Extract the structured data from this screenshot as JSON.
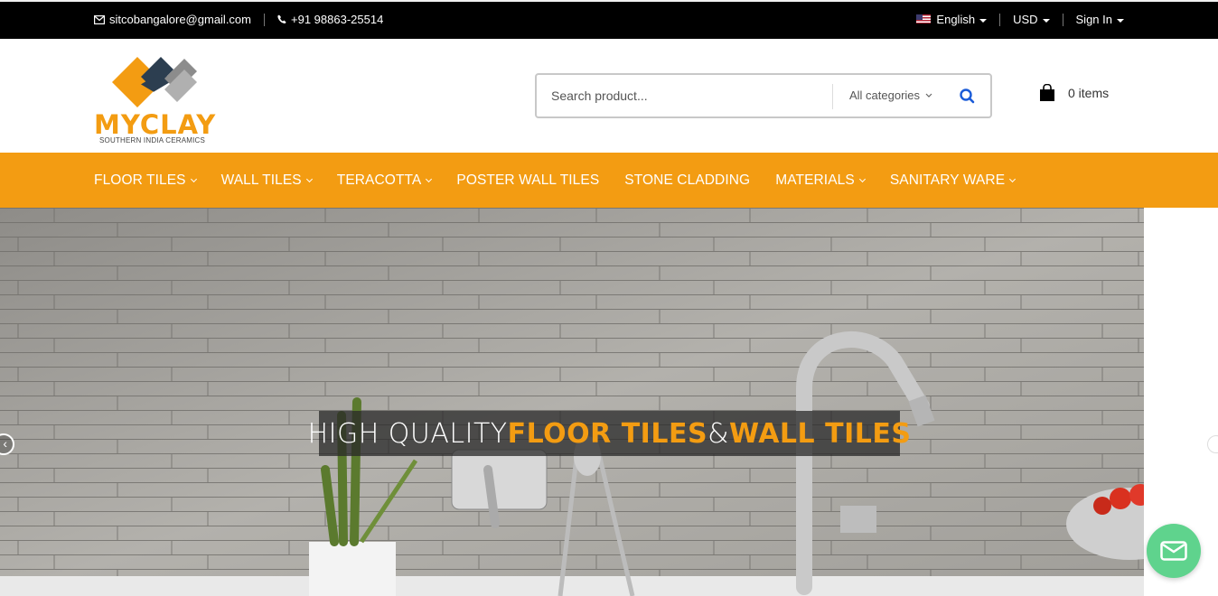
{
  "topbar": {
    "email": "sitcobangalore@gmail.com",
    "phone": "+91 98863-25514",
    "language": "English",
    "currency": "USD",
    "signin": "Sign In"
  },
  "logo": {
    "brand": "MYCLAY",
    "tagline": "SOUTHERN INDIA CERAMICS"
  },
  "search": {
    "placeholder": "Search product...",
    "category": "All categories"
  },
  "cart": {
    "label": "0 items"
  },
  "nav": [
    {
      "label": "FLOOR TILES"
    },
    {
      "label": "WALL TILES"
    },
    {
      "label": "TERACOTTA"
    },
    {
      "label": "POSTER WALL TILES"
    },
    {
      "label": "STONE CLADDING"
    },
    {
      "label": "MATERIALS"
    },
    {
      "label": "SANITARY WARE"
    }
  ],
  "hero": {
    "caption_part1": "HIGH QUALITY ",
    "caption_part2": "FLOOR TILES",
    "caption_part3": " & ",
    "caption_part4": "WALL TILES"
  },
  "colors": {
    "accent": "#f39c12",
    "topbar": "#000000",
    "chat": "#5fd38d",
    "search_icon": "#1a5bd8"
  },
  "icons": [
    "envelope-icon",
    "phone-icon",
    "us-flag-icon",
    "search-icon",
    "shopping-bag-icon",
    "chevron-down-icon",
    "chevron-left-icon",
    "chevron-right-icon",
    "mail-chat-icon"
  ]
}
